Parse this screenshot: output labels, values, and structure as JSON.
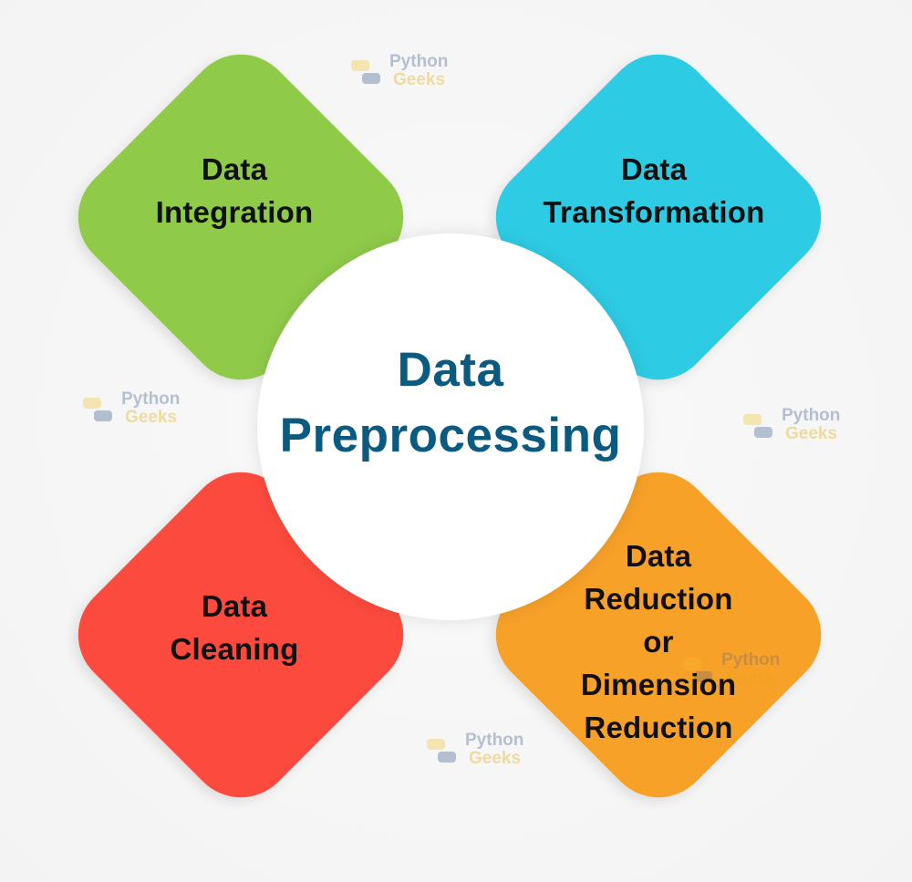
{
  "diagram": {
    "center": {
      "lines": [
        "Data",
        "Preprocessing"
      ],
      "color": "#0b5a80"
    },
    "steps": [
      {
        "position": "top-left",
        "lines": [
          "Data",
          "Integration"
        ],
        "color": "#8fcb49"
      },
      {
        "position": "top-right",
        "lines": [
          "Data",
          "Transformation"
        ],
        "color": "#2ecbe4"
      },
      {
        "position": "bottom-left",
        "lines": [
          "Data",
          "Cleaning"
        ],
        "color": "#fd4a3e"
      },
      {
        "position": "bottom-right",
        "lines": [
          "Data",
          "Reduction",
          "or",
          "Dimension",
          "Reduction"
        ],
        "color": "#f7a129"
      }
    ],
    "watermark": {
      "line1": "Python",
      "line2": "Geeks",
      "icon": "python-geeks-logo-icon"
    }
  }
}
